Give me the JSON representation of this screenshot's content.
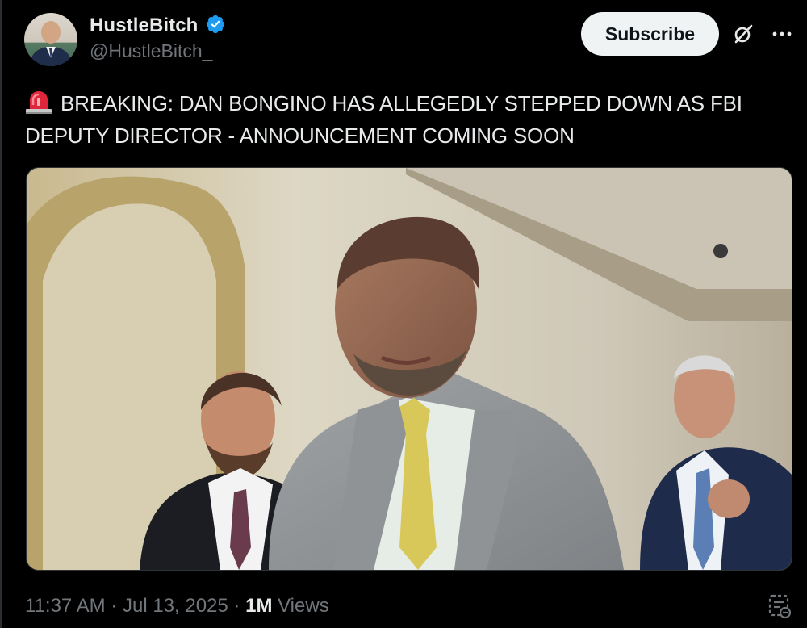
{
  "author": {
    "display_name": "HustleBitch",
    "handle": "@HustleBitch_",
    "verified": true
  },
  "actions": {
    "subscribe_label": "Subscribe"
  },
  "post": {
    "emoji": "🚨",
    "text": "BREAKING: DAN BONGINO HAS ALLEGEDLY STEPPED DOWN AS FBI DEPUTY DIRECTOR - ANNOUNCEMENT COMING SOON"
  },
  "meta": {
    "time": "11:37 AM",
    "sep1": "·",
    "date": "Jul 13, 2025",
    "sep2": "·",
    "views_count": "1M",
    "views_label": "Views"
  },
  "colors": {
    "background": "#000000",
    "text_primary": "#e7e9ea",
    "text_secondary": "#71767b",
    "verified": "#1d9bf0",
    "subscribe_bg": "#eff3f4"
  },
  "icons": [
    "verified-badge-icon",
    "grok-icon",
    "more-icon",
    "siren-icon",
    "analytics-icon"
  ]
}
